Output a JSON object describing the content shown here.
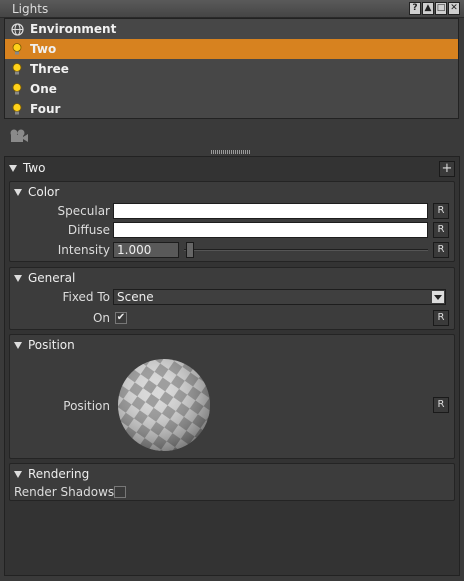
{
  "window": {
    "title": "Lights",
    "buttons": [
      "?",
      "▲",
      "□",
      "✕"
    ]
  },
  "lights": [
    {
      "label": "Environment",
      "icon": "globe-icon",
      "selected": false
    },
    {
      "label": "Two",
      "icon": "bulb-icon",
      "selected": true
    },
    {
      "label": "Three",
      "icon": "bulb-icon",
      "selected": false
    },
    {
      "label": "One",
      "icon": "bulb-icon",
      "selected": false
    },
    {
      "label": "Four",
      "icon": "bulb-icon",
      "selected": false
    }
  ],
  "panel": {
    "title": "Two",
    "add_label": "+",
    "reset_label": "R",
    "color": {
      "header": "Color",
      "specular_label": "Specular",
      "diffuse_label": "Diffuse",
      "intensity_label": "Intensity",
      "intensity_value": "1.000",
      "specular_color": "#ffffff",
      "diffuse_color": "#ffffff"
    },
    "general": {
      "header": "General",
      "fixed_to_label": "Fixed To",
      "fixed_to_value": "Scene",
      "on_label": "On",
      "on_checked": "✔"
    },
    "position": {
      "header": "Position",
      "position_label": "Position"
    },
    "rendering": {
      "header": "Rendering",
      "render_shadows_label": "Render Shadows"
    }
  },
  "colors": {
    "accent": "#d7821f"
  }
}
